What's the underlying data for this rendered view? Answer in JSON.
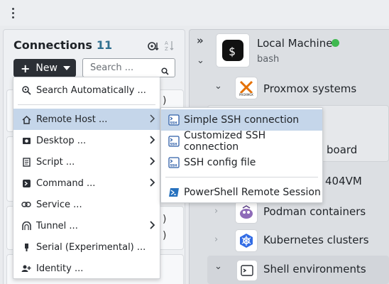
{
  "connections": {
    "title": "Connections",
    "count": "11",
    "new_button": "New",
    "search_placeholder": "Search ..."
  },
  "background_fragments": {
    "paren1": ")",
    "paren2": ")",
    "paren3": ")"
  },
  "new_menu": {
    "items": [
      {
        "label": "Search Automatically ...",
        "icon": "search-auto-icon"
      },
      {
        "label": "Remote Host ...",
        "icon": "home-icon",
        "submenu": true,
        "highlighted": true
      },
      {
        "label": "Desktop ...",
        "icon": "desktop-icon",
        "submenu": true
      },
      {
        "label": "Script ...",
        "icon": "script-icon",
        "submenu": true
      },
      {
        "label": "Command ...",
        "icon": "command-icon",
        "submenu": true
      },
      {
        "label": "Service ...",
        "icon": "service-link-icon"
      },
      {
        "label": "Tunnel ...",
        "icon": "tunnel-icon",
        "submenu": true
      },
      {
        "label": "Serial (Experimental) ...",
        "icon": "serial-icon"
      },
      {
        "label": "Identity ...",
        "icon": "identity-icon"
      }
    ]
  },
  "remote_host_submenu": {
    "items": [
      {
        "label": "Simple SSH connection",
        "icon": "ssh-icon",
        "highlighted": true
      },
      {
        "label": "Customized SSH connection",
        "icon": "ssh-icon"
      },
      {
        "label": "SSH config file",
        "icon": "ssh-icon"
      },
      {
        "label": "PowerShell Remote Session",
        "icon": "powershell-icon"
      }
    ]
  },
  "tree": {
    "local_machine": {
      "label": "Local Machine",
      "sub": "bash",
      "status_color": "#3fb950"
    },
    "proxmox": {
      "label": "Proxmox systems"
    },
    "fragment_board": "board",
    "fragment_vm": "404VM",
    "podman": {
      "label": "Podman containers"
    },
    "kubernetes": {
      "label": "Kubernetes clusters"
    },
    "shell": {
      "label": "Shell environments"
    }
  },
  "colors": {
    "accent_count": "#2f6f8f",
    "highlight": "#c5d6ea",
    "new_button_bg": "#2b2f35",
    "status_online": "#3fb950"
  }
}
